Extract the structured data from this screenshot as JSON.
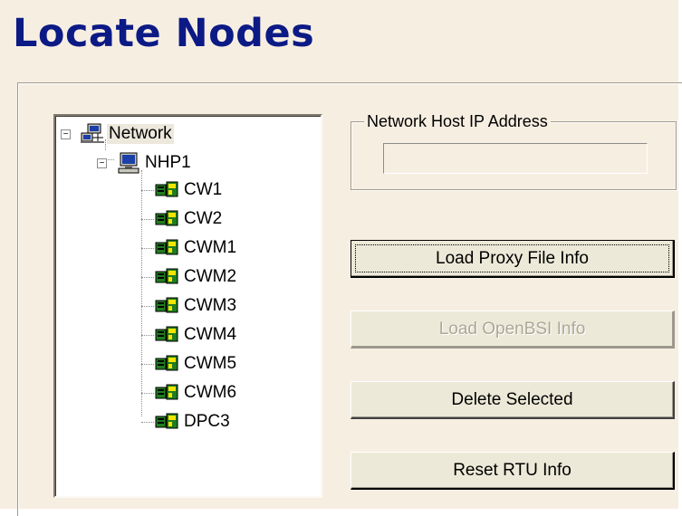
{
  "page": {
    "title": "Locate Nodes"
  },
  "tree": {
    "root": {
      "label": "Network",
      "icon": "network-icon",
      "expander": "−"
    },
    "host": {
      "label": "NHP1",
      "icon": "computer-icon",
      "expander": "−"
    },
    "nodes": [
      {
        "label": "CW1",
        "icon": "rtu-icon"
      },
      {
        "label": "CW2",
        "icon": "rtu-icon"
      },
      {
        "label": "CWM1",
        "icon": "rtu-icon"
      },
      {
        "label": "CWM2",
        "icon": "rtu-icon"
      },
      {
        "label": "CWM3",
        "icon": "rtu-icon"
      },
      {
        "label": "CWM4",
        "icon": "rtu-icon"
      },
      {
        "label": "CWM5",
        "icon": "rtu-icon"
      },
      {
        "label": "CWM6",
        "icon": "rtu-icon"
      },
      {
        "label": "DPC3",
        "icon": "rtu-icon"
      }
    ]
  },
  "host_ip": {
    "label": "Network Host IP Address",
    "value": ""
  },
  "buttons": {
    "load_proxy": "Load Proxy File Info",
    "load_openbsi": "Load OpenBSI Info",
    "delete_selected": "Delete Selected",
    "reset_rtu": "Reset RTU Info"
  },
  "colors": {
    "title": "#0c1a85",
    "background": "#f7eee2",
    "button_face": "#ece9d8",
    "rtu_green": "#1f7d1f",
    "rtu_yellow": "#f5e400"
  }
}
